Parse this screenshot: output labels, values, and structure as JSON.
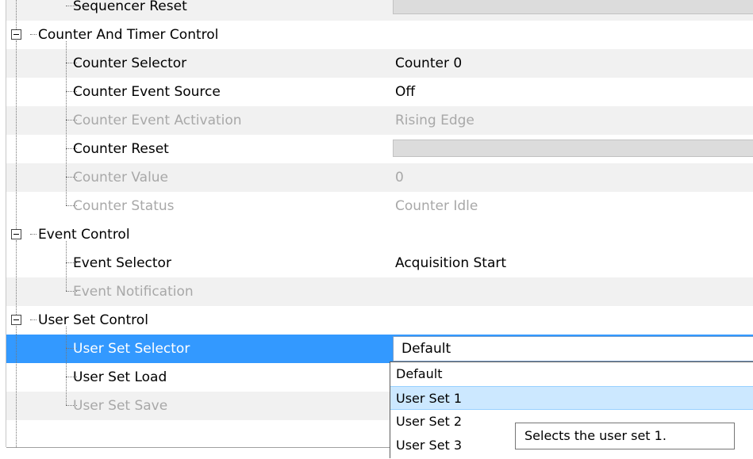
{
  "rows": [
    {
      "kind": "prop",
      "name": "Sequencer Reset",
      "value": "",
      "button": true,
      "disabled": false,
      "alt": true
    },
    {
      "kind": "category",
      "name": "Counter And Timer Control"
    },
    {
      "kind": "prop",
      "name": "Counter Selector",
      "value": "Counter 0",
      "disabled": false,
      "alt": true
    },
    {
      "kind": "prop",
      "name": "Counter Event Source",
      "value": "Off",
      "disabled": false,
      "alt": false
    },
    {
      "kind": "prop",
      "name": "Counter Event Activation",
      "value": "Rising Edge",
      "disabled": true,
      "alt": true
    },
    {
      "kind": "prop",
      "name": "Counter Reset",
      "value": "",
      "button": true,
      "disabled": false,
      "alt": false
    },
    {
      "kind": "prop",
      "name": "Counter Value",
      "value": "0",
      "disabled": true,
      "alt": true
    },
    {
      "kind": "prop",
      "name": "Counter Status",
      "value": "Counter Idle",
      "disabled": true,
      "alt": false
    },
    {
      "kind": "category",
      "name": "Event Control"
    },
    {
      "kind": "prop",
      "name": "Event Selector",
      "value": "Acquisition Start",
      "disabled": false,
      "alt": false
    },
    {
      "kind": "prop",
      "name": "Event Notification",
      "value": "",
      "disabled": true,
      "alt": true
    },
    {
      "kind": "category",
      "name": "User Set Control"
    },
    {
      "kind": "prop",
      "name": "User Set Selector",
      "value": "Default",
      "selected": true,
      "combo": true,
      "disabled": false
    },
    {
      "kind": "prop",
      "name": "User Set Load",
      "value": "",
      "disabled": false,
      "alt": false
    },
    {
      "kind": "prop",
      "name": "User Set Save",
      "value": "",
      "disabled": true,
      "alt": true
    }
  ],
  "dropdown": {
    "options": [
      "Default",
      "User Set 1",
      "User Set 2",
      "User Set 3"
    ],
    "highlighted_index": 1
  },
  "tooltip": "Selects the user set 1.",
  "colors": {
    "selection": "#3399ff",
    "disabled_text": "#a8a8a8",
    "alt_row": "#f1f1f1",
    "option_highlight": "#cce8ff"
  }
}
